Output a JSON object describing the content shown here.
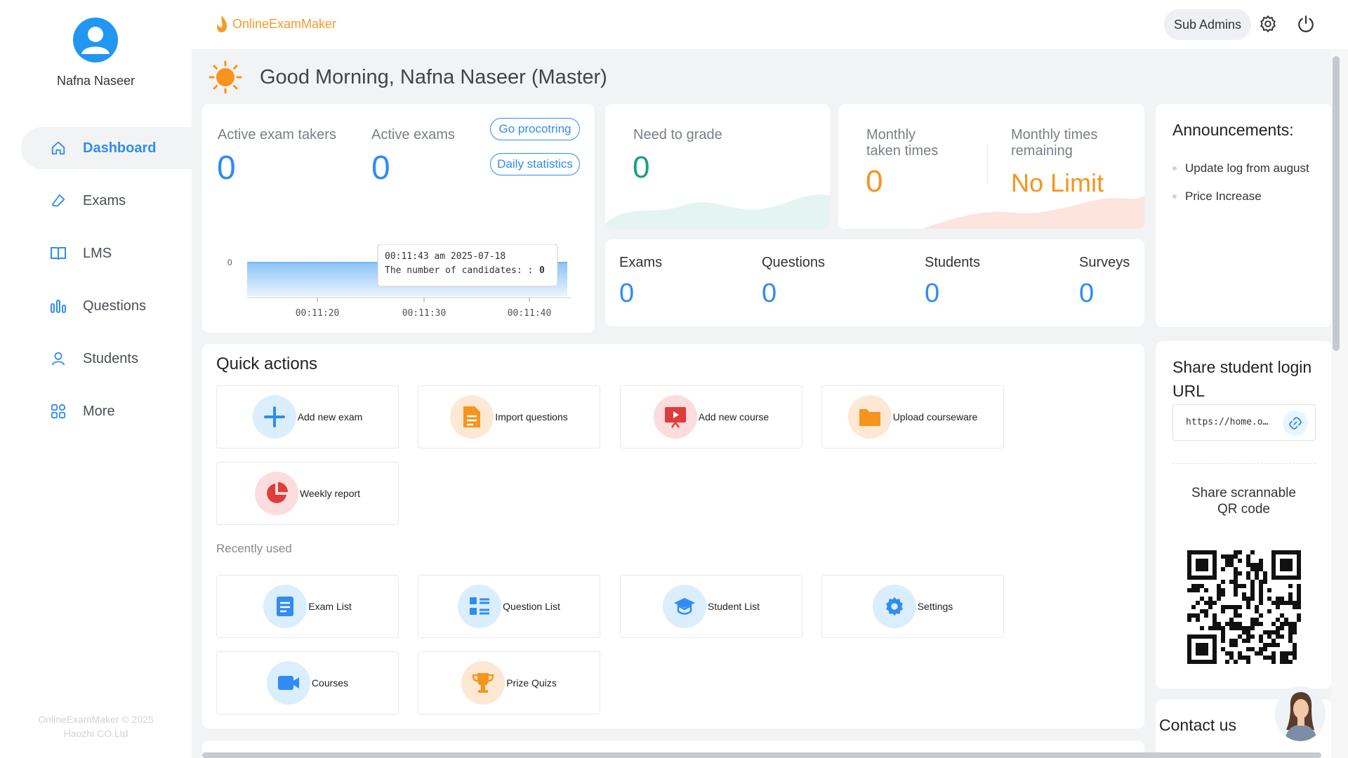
{
  "user": {
    "name": "Nafna Naseer"
  },
  "sidebar": {
    "items": [
      {
        "label": "Dashboard",
        "icon": "home-icon",
        "active": true
      },
      {
        "label": "Exams",
        "icon": "eraser-icon"
      },
      {
        "label": "LMS",
        "icon": "book-icon"
      },
      {
        "label": "Questions",
        "icon": "bar-chart-icon"
      },
      {
        "label": "Students",
        "icon": "person-icon"
      },
      {
        "label": "More",
        "icon": "apps-icon"
      }
    ],
    "copyright_line1": "OnlineExamMaker © 2025",
    "copyright_line2": "Haozhi CO.Ltd"
  },
  "header": {
    "logo_text": "OnlineExamMaker",
    "role_button": "Sub Admins"
  },
  "greeting": {
    "text": "Good Morning, Nafna Naseer  (Master)"
  },
  "active_card": {
    "takers_label": "Active exam takers",
    "takers_value": "0",
    "exams_label": "Active exams",
    "exams_value": "0",
    "proctoring_btn": "Go procotring",
    "daily_btn": "Daily statistics",
    "chart_y_tick": "0",
    "chart_x_ticks": [
      "00:11:20",
      "00:11:30",
      "00:11:40"
    ],
    "tooltip_time": "00:11:43 am 2025-07-18",
    "tooltip_label": "The number of candidates: :",
    "tooltip_value": "0"
  },
  "chart_data": {
    "type": "area",
    "x": [
      "00:11:20",
      "00:11:30",
      "00:11:40"
    ],
    "series": [
      {
        "values": [
          0,
          0,
          0
        ]
      }
    ],
    "ylim": [
      0,
      0
    ]
  },
  "grade_card": {
    "label": "Need to grade",
    "value": "0"
  },
  "monthly_card": {
    "taken_label_1": "Monthly",
    "taken_label_2": "taken times",
    "taken_value": "0",
    "remaining_label_1": "Monthly times",
    "remaining_label_2": "remaining",
    "remaining_value": "No Limit"
  },
  "stats": [
    {
      "label": "Exams",
      "value": "0"
    },
    {
      "label": "Questions",
      "value": "0"
    },
    {
      "label": "Students",
      "value": "0"
    },
    {
      "label": "Surveys",
      "value": "0"
    }
  ],
  "announcements": {
    "title": "Announcements:",
    "items": [
      "Update log from august",
      "Price Increase"
    ]
  },
  "quick_actions": {
    "title": "Quick actions",
    "items": [
      {
        "label": "Add new exam",
        "icon": "plus-icon"
      },
      {
        "label": "Import questions",
        "icon": "document-icon"
      },
      {
        "label": "Add new course",
        "icon": "presentation-icon"
      },
      {
        "label": "Upload courseware",
        "icon": "folder-icon"
      },
      {
        "label": "Weekly report",
        "icon": "pie-chart-icon"
      }
    ],
    "recent_title": "Recently used",
    "recent": [
      {
        "label": "Exam List",
        "icon": "list-doc-icon"
      },
      {
        "label": "Question List",
        "icon": "list-icon"
      },
      {
        "label": "Student List",
        "icon": "graduation-cap-icon"
      },
      {
        "label": "Settings",
        "icon": "gear-icon"
      },
      {
        "label": "Courses",
        "icon": "video-icon"
      },
      {
        "label": "Prize Quizs",
        "icon": "trophy-icon"
      }
    ]
  },
  "share": {
    "title_line1": "Share student login",
    "title_line2": "URL",
    "url": "https://home.o…",
    "qr_title_line1": "Share scrannable",
    "qr_title_line2": "QR code"
  },
  "contact": {
    "title": "Contact us"
  }
}
